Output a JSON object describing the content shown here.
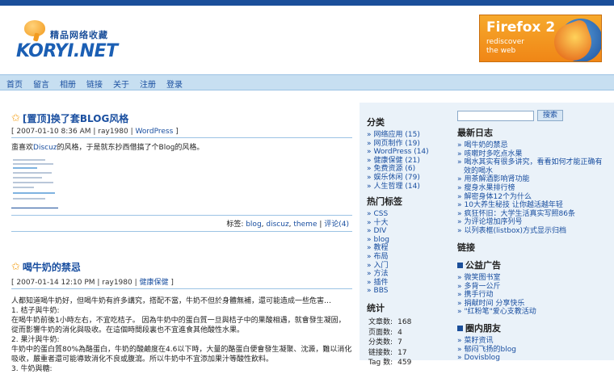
{
  "header": {
    "logo_cn": "精品网络收藏",
    "logo_en": "KORYI.NET",
    "banner_title": "Firefox 2",
    "banner_sub1": "rediscover",
    "banner_sub2": "the web"
  },
  "nav": [
    "首页",
    "留言",
    "相册",
    "链接",
    "关于",
    "注册",
    "登录"
  ],
  "posts": [
    {
      "title": "[置顶]换了套BLOG风格",
      "meta_date": "[ 2007-01-10 8:36 AM | ray1980 | ",
      "meta_cat": "WordPress",
      "meta_end": " ]",
      "body_pre": "蛮喜欢",
      "body_link": "Discuz",
      "body_post": "的风格，于是就东抄西借搞了个Blog的风格。",
      "tags_label": "标签: ",
      "tags": [
        "blog",
        "discuz",
        "theme"
      ],
      "comments": "评论(4)"
    },
    {
      "title": "喝牛奶的禁忌",
      "meta_date": "[ 2007-01-14 12:10 PM | ray1980 | ",
      "meta_cat": "健康保健",
      "meta_end": " ]",
      "lines": [
        "人都知道喝牛奶好，但喝牛奶有許多講究，搭配不當，牛奶不但於身體無補，還可能造成一些危害…",
        "1. 桔子與牛奶:",
        "在喝牛奶前後1小時左右，不宜吃桔子。 因為牛奶中的蛋白質一旦與桔子中的果酸相遇，就會發生凝固，",
        "從而影響牛奶的消化與吸收。在這個時間段裏也不宜進食其他酸性水果。",
        "2. 果汁與牛奶:",
        "牛奶中的蛋白質80%為酪蛋白，牛奶的酸鹼度在4.6以下時，大量的酪蛋白便會發生凝聚、沈澱，難以消化",
        "吸收，嚴重者還可能導致消化不良或腹瀉。所以牛奶中不宜添加果汁等酸性飲料。",
        "3. 牛奶與糖:"
      ]
    }
  ],
  "sidebar1": {
    "categories_title": "分类",
    "categories": [
      "网络应用 (15)",
      "网页制作 (19)",
      "WordPress (14)",
      "健康保健 (21)",
      "免费资源 (6)",
      "娱乐休闲 (79)",
      "人生哲理 (14)"
    ],
    "tags_title": "热门标签",
    "tags": [
      "CSS",
      "十大",
      "DIV",
      "blog",
      "教程",
      "布局",
      "入门",
      "方法",
      "插件",
      "BBS"
    ],
    "stats_title": "统计",
    "stats": [
      {
        "label": "文章数:",
        "value": "168"
      },
      {
        "label": "页面数:",
        "value": "4"
      },
      {
        "label": "分类数:",
        "value": "7"
      },
      {
        "label": "链接数:",
        "value": "17"
      },
      {
        "label": "Tag 数:",
        "value": "459"
      }
    ]
  },
  "sidebar2": {
    "search_button": "搜索",
    "recent_title": "最新日志",
    "recent": [
      "喝牛奶的禁忌",
      "咳嗽时多吃点水果",
      "喝水其实有很多讲究，看看如何才能正确有效的喝水",
      "用茶解酒影响肾功能",
      "瘦身水果排行榜",
      "解密身体12个为什么",
      "10大养生秘技 让你越活越年轻",
      "疯狂怀旧：大学生活真实写照86条",
      "为评论增加序列号",
      "以列表框(listbox)方式显示归档"
    ],
    "links_title": "链接",
    "charity_title": "公益广告",
    "charity": [
      "微笑图书室",
      "多背一公斤",
      "携手行动",
      "捐献时间 分享快乐",
      "\"红粉笔\"爱心支教活动"
    ],
    "friends_title": "圈内朋友",
    "friends": [
      "菜籽资讯",
      "郁闷飞扬的blog",
      "Dovisblog"
    ]
  }
}
